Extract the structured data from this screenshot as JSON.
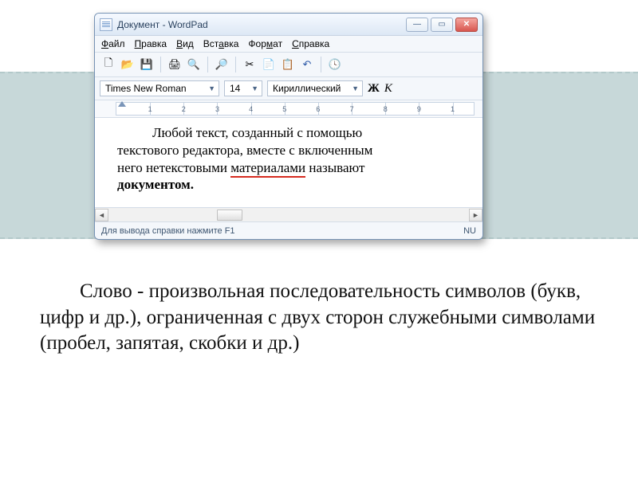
{
  "window": {
    "title": "Документ - WordPad",
    "menu": [
      "Файл",
      "Правка",
      "Вид",
      "Вставка",
      "Формат",
      "Справка"
    ],
    "font_name": "Times New Roman",
    "font_size": "14",
    "charset": "Кириллический",
    "bold_label": "Ж",
    "italic_label": "К",
    "ruler_numbers": [
      "1",
      "2",
      "3",
      "4",
      "5",
      "6",
      "7",
      "8",
      "9",
      "1"
    ],
    "doc_text": {
      "line1a": "Любой текст, созданный с помощью",
      "line2": "текстового редактора, вместе с включенным",
      "line3a": "него нетекстовыми ",
      "line3_underlined": "материалами",
      "line3b": " называют",
      "line4_bold": "документом."
    },
    "status_left": "Для вывода справки нажмите F1",
    "status_right": "NU"
  },
  "caption": {
    "text": "Слово - произвольная последовательность символов (букв, цифр и др.), ограниченная с двух сторон служебными символами (пробел, запятая, скобки и др.)"
  }
}
